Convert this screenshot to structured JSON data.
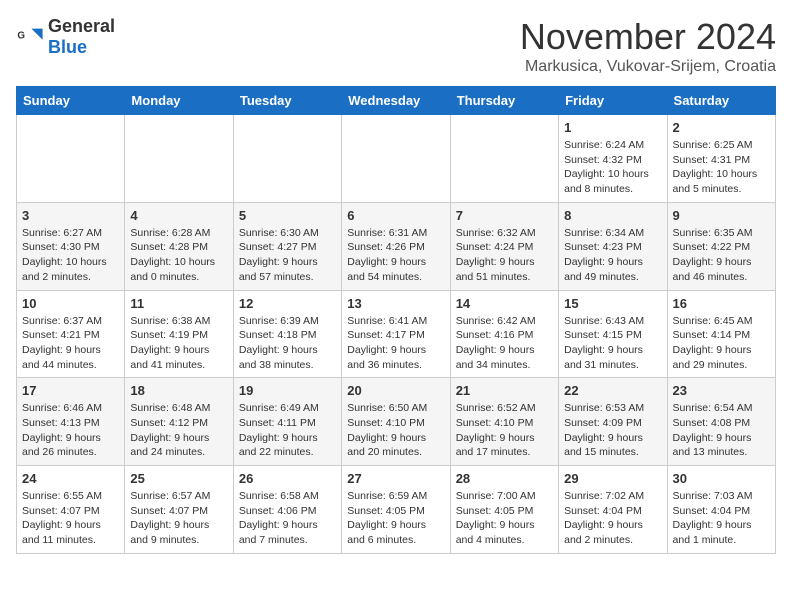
{
  "header": {
    "logo_general": "General",
    "logo_blue": "Blue",
    "month_title": "November 2024",
    "location": "Markusica, Vukovar-Srijem, Croatia"
  },
  "days_of_week": [
    "Sunday",
    "Monday",
    "Tuesday",
    "Wednesday",
    "Thursday",
    "Friday",
    "Saturday"
  ],
  "weeks": [
    [
      {
        "day": "",
        "info": ""
      },
      {
        "day": "",
        "info": ""
      },
      {
        "day": "",
        "info": ""
      },
      {
        "day": "",
        "info": ""
      },
      {
        "day": "",
        "info": ""
      },
      {
        "day": "1",
        "info": "Sunrise: 6:24 AM\nSunset: 4:32 PM\nDaylight: 10 hours and 8 minutes."
      },
      {
        "day": "2",
        "info": "Sunrise: 6:25 AM\nSunset: 4:31 PM\nDaylight: 10 hours and 5 minutes."
      }
    ],
    [
      {
        "day": "3",
        "info": "Sunrise: 6:27 AM\nSunset: 4:30 PM\nDaylight: 10 hours and 2 minutes."
      },
      {
        "day": "4",
        "info": "Sunrise: 6:28 AM\nSunset: 4:28 PM\nDaylight: 10 hours and 0 minutes."
      },
      {
        "day": "5",
        "info": "Sunrise: 6:30 AM\nSunset: 4:27 PM\nDaylight: 9 hours and 57 minutes."
      },
      {
        "day": "6",
        "info": "Sunrise: 6:31 AM\nSunset: 4:26 PM\nDaylight: 9 hours and 54 minutes."
      },
      {
        "day": "7",
        "info": "Sunrise: 6:32 AM\nSunset: 4:24 PM\nDaylight: 9 hours and 51 minutes."
      },
      {
        "day": "8",
        "info": "Sunrise: 6:34 AM\nSunset: 4:23 PM\nDaylight: 9 hours and 49 minutes."
      },
      {
        "day": "9",
        "info": "Sunrise: 6:35 AM\nSunset: 4:22 PM\nDaylight: 9 hours and 46 minutes."
      }
    ],
    [
      {
        "day": "10",
        "info": "Sunrise: 6:37 AM\nSunset: 4:21 PM\nDaylight: 9 hours and 44 minutes."
      },
      {
        "day": "11",
        "info": "Sunrise: 6:38 AM\nSunset: 4:19 PM\nDaylight: 9 hours and 41 minutes."
      },
      {
        "day": "12",
        "info": "Sunrise: 6:39 AM\nSunset: 4:18 PM\nDaylight: 9 hours and 38 minutes."
      },
      {
        "day": "13",
        "info": "Sunrise: 6:41 AM\nSunset: 4:17 PM\nDaylight: 9 hours and 36 minutes."
      },
      {
        "day": "14",
        "info": "Sunrise: 6:42 AM\nSunset: 4:16 PM\nDaylight: 9 hours and 34 minutes."
      },
      {
        "day": "15",
        "info": "Sunrise: 6:43 AM\nSunset: 4:15 PM\nDaylight: 9 hours and 31 minutes."
      },
      {
        "day": "16",
        "info": "Sunrise: 6:45 AM\nSunset: 4:14 PM\nDaylight: 9 hours and 29 minutes."
      }
    ],
    [
      {
        "day": "17",
        "info": "Sunrise: 6:46 AM\nSunset: 4:13 PM\nDaylight: 9 hours and 26 minutes."
      },
      {
        "day": "18",
        "info": "Sunrise: 6:48 AM\nSunset: 4:12 PM\nDaylight: 9 hours and 24 minutes."
      },
      {
        "day": "19",
        "info": "Sunrise: 6:49 AM\nSunset: 4:11 PM\nDaylight: 9 hours and 22 minutes."
      },
      {
        "day": "20",
        "info": "Sunrise: 6:50 AM\nSunset: 4:10 PM\nDaylight: 9 hours and 20 minutes."
      },
      {
        "day": "21",
        "info": "Sunrise: 6:52 AM\nSunset: 4:10 PM\nDaylight: 9 hours and 17 minutes."
      },
      {
        "day": "22",
        "info": "Sunrise: 6:53 AM\nSunset: 4:09 PM\nDaylight: 9 hours and 15 minutes."
      },
      {
        "day": "23",
        "info": "Sunrise: 6:54 AM\nSunset: 4:08 PM\nDaylight: 9 hours and 13 minutes."
      }
    ],
    [
      {
        "day": "24",
        "info": "Sunrise: 6:55 AM\nSunset: 4:07 PM\nDaylight: 9 hours and 11 minutes."
      },
      {
        "day": "25",
        "info": "Sunrise: 6:57 AM\nSunset: 4:07 PM\nDaylight: 9 hours and 9 minutes."
      },
      {
        "day": "26",
        "info": "Sunrise: 6:58 AM\nSunset: 4:06 PM\nDaylight: 9 hours and 7 minutes."
      },
      {
        "day": "27",
        "info": "Sunrise: 6:59 AM\nSunset: 4:05 PM\nDaylight: 9 hours and 6 minutes."
      },
      {
        "day": "28",
        "info": "Sunrise: 7:00 AM\nSunset: 4:05 PM\nDaylight: 9 hours and 4 minutes."
      },
      {
        "day": "29",
        "info": "Sunrise: 7:02 AM\nSunset: 4:04 PM\nDaylight: 9 hours and 2 minutes."
      },
      {
        "day": "30",
        "info": "Sunrise: 7:03 AM\nSunset: 4:04 PM\nDaylight: 9 hours and 1 minute."
      }
    ]
  ]
}
